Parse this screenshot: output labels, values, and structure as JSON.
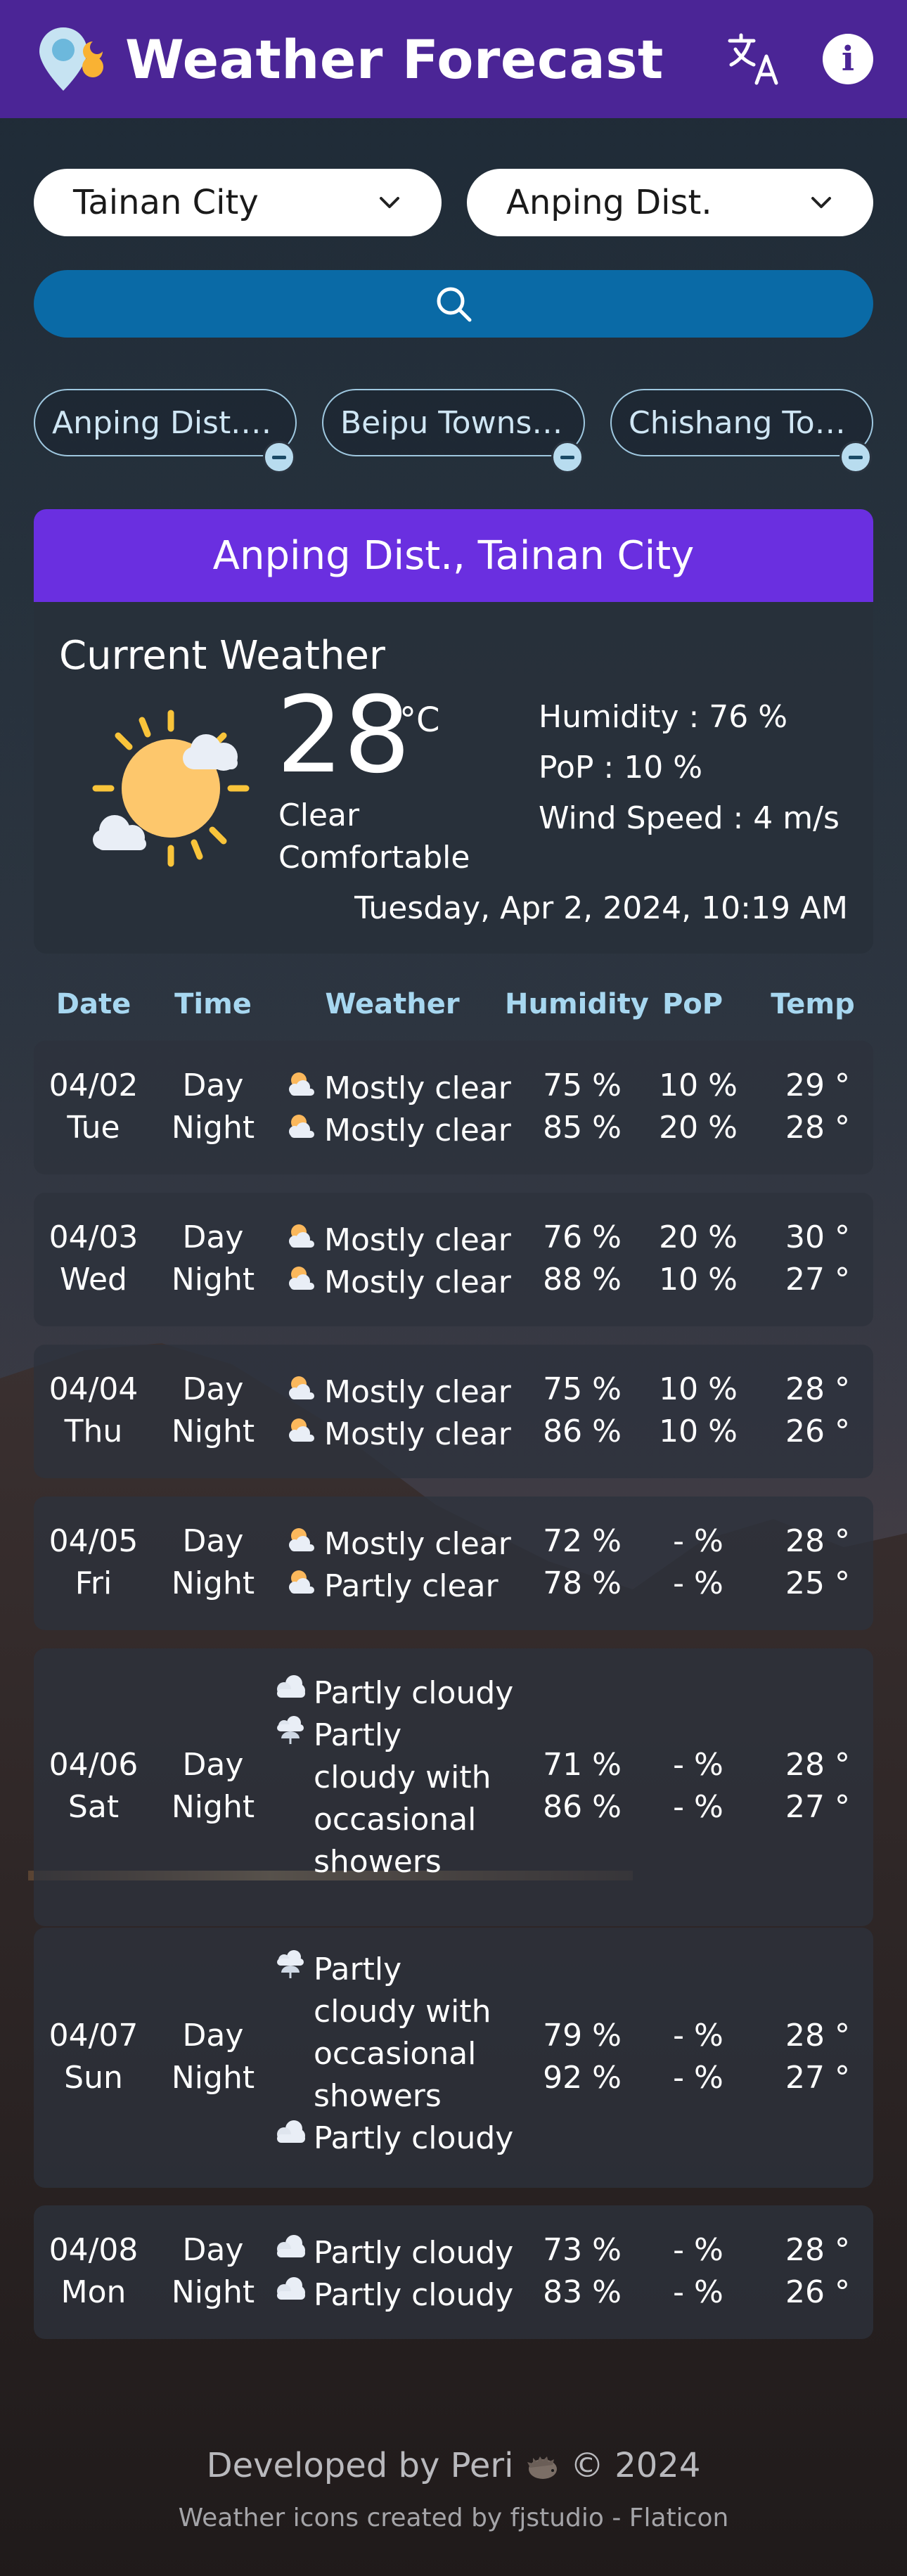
{
  "header": {
    "title": "Weather Forecast",
    "translate_icon": "translate-icon",
    "info_icon": "info-icon",
    "info_label": "i",
    "bg_color": "#4b2596"
  },
  "selectors": {
    "city": "Tainan City",
    "district": "Anping Dist."
  },
  "search": {
    "icon": "search-icon",
    "color": "#0a6aa6"
  },
  "saved_locations": [
    "Anping Dist., Tainan City",
    "Beipu Township, Hsinchu County",
    "Chishang Township, Taitung County"
  ],
  "location_title": "Anping Dist., Tainan City",
  "current": {
    "title": "Current Weather",
    "temperature": "28",
    "unit": "°C",
    "condition": "Clear",
    "comfort": "Comfortable",
    "humidity": "Humidity : 76 %",
    "pop": "PoP : 10 %",
    "wind": "Wind Speed : 4 m/s",
    "datetime": "Tuesday, Apr 2, 2024, 10:19 AM"
  },
  "table_headers": [
    "Date",
    "Time",
    "Weather",
    "Humidity",
    "PoP",
    "Temp"
  ],
  "periods": {
    "day": "Day",
    "night": "Night"
  },
  "forecast": [
    {
      "date": "04/02",
      "weekday": "Tue",
      "day_weather": "Mostly clear",
      "night_weather": "Mostly clear",
      "day_humidity": "75 %",
      "night_humidity": "85 %",
      "day_pop": "10 %",
      "night_pop": "20 %",
      "day_temp": "29 °",
      "night_temp": "28 °"
    },
    {
      "date": "04/03",
      "weekday": "Wed",
      "day_weather": "Mostly clear",
      "night_weather": "Mostly clear",
      "day_humidity": "76 %",
      "night_humidity": "88 %",
      "day_pop": "20 %",
      "night_pop": "10 %",
      "day_temp": "30 °",
      "night_temp": "27 °"
    },
    {
      "date": "04/04",
      "weekday": "Thu",
      "day_weather": "Mostly clear",
      "night_weather": "Mostly clear",
      "day_humidity": "75 %",
      "night_humidity": "86 %",
      "day_pop": "10 %",
      "night_pop": "10 %",
      "day_temp": "28 °",
      "night_temp": "26 °"
    },
    {
      "date": "04/05",
      "weekday": "Fri",
      "day_weather": "Mostly clear",
      "night_weather": "Partly clear",
      "day_humidity": "72 %",
      "night_humidity": "78 %",
      "day_pop": "- %",
      "night_pop": "- %",
      "day_temp": "28 °",
      "night_temp": "25 °"
    },
    {
      "date": "04/06",
      "weekday": "Sat",
      "day_weather": "Partly cloudy",
      "night_weather": "Partly cloudy with occasional showers",
      "day_humidity": "71 %",
      "night_humidity": "86 %",
      "day_pop": "- %",
      "night_pop": "- %",
      "day_temp": "28 °",
      "night_temp": "27 °"
    },
    {
      "date": "04/07",
      "weekday": "Sun",
      "day_weather": "Partly cloudy with occasional showers",
      "night_weather": "Partly cloudy",
      "day_humidity": "79 %",
      "night_humidity": "92 %",
      "day_pop": "- %",
      "night_pop": "- %",
      "day_temp": "28 °",
      "night_temp": "27 °"
    },
    {
      "date": "04/08",
      "weekday": "Mon",
      "day_weather": "Partly cloudy",
      "night_weather": "Partly cloudy",
      "day_humidity": "73 %",
      "night_humidity": "83 %",
      "day_pop": "- %",
      "night_pop": "- %",
      "day_temp": "28 °",
      "night_temp": "26 °"
    }
  ],
  "footer": {
    "developer": "Developed by Peri",
    "copyright": "© 2024",
    "credits": "Weather icons created by fjstudio - Flaticon"
  }
}
